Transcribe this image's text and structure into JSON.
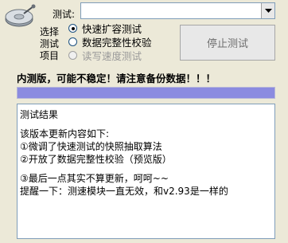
{
  "drive": {
    "label": "测试:",
    "value": "",
    "icon": "disk-drive-icon"
  },
  "mode": {
    "title_lines": [
      "选择",
      "测试",
      "项目"
    ],
    "options": [
      {
        "label": "快速扩容测试",
        "checked": true,
        "disabled": false
      },
      {
        "label": "数据完整性校验",
        "checked": false,
        "disabled": false
      },
      {
        "label": "读写速度测试",
        "checked": false,
        "disabled": true
      }
    ]
  },
  "stop_button": {
    "label": "停止测试"
  },
  "warning": "内测版，可能不稳定！请注意备份数据！！！",
  "progress": {
    "fraction": 1.0,
    "color": "#8b8be0",
    "track_color": "#ccccee"
  },
  "result": {
    "lines": [
      "测试结果",
      "",
      "该版本更新内容如下:",
      "①微调了快速测试的快照抽取算法",
      "②开放了数据完整性校验（预览版）",
      "",
      "③最后一点其实不算更新，呵呵~~",
      "提醒一下：测速模块一直无效，和v2.93是一样的"
    ]
  }
}
